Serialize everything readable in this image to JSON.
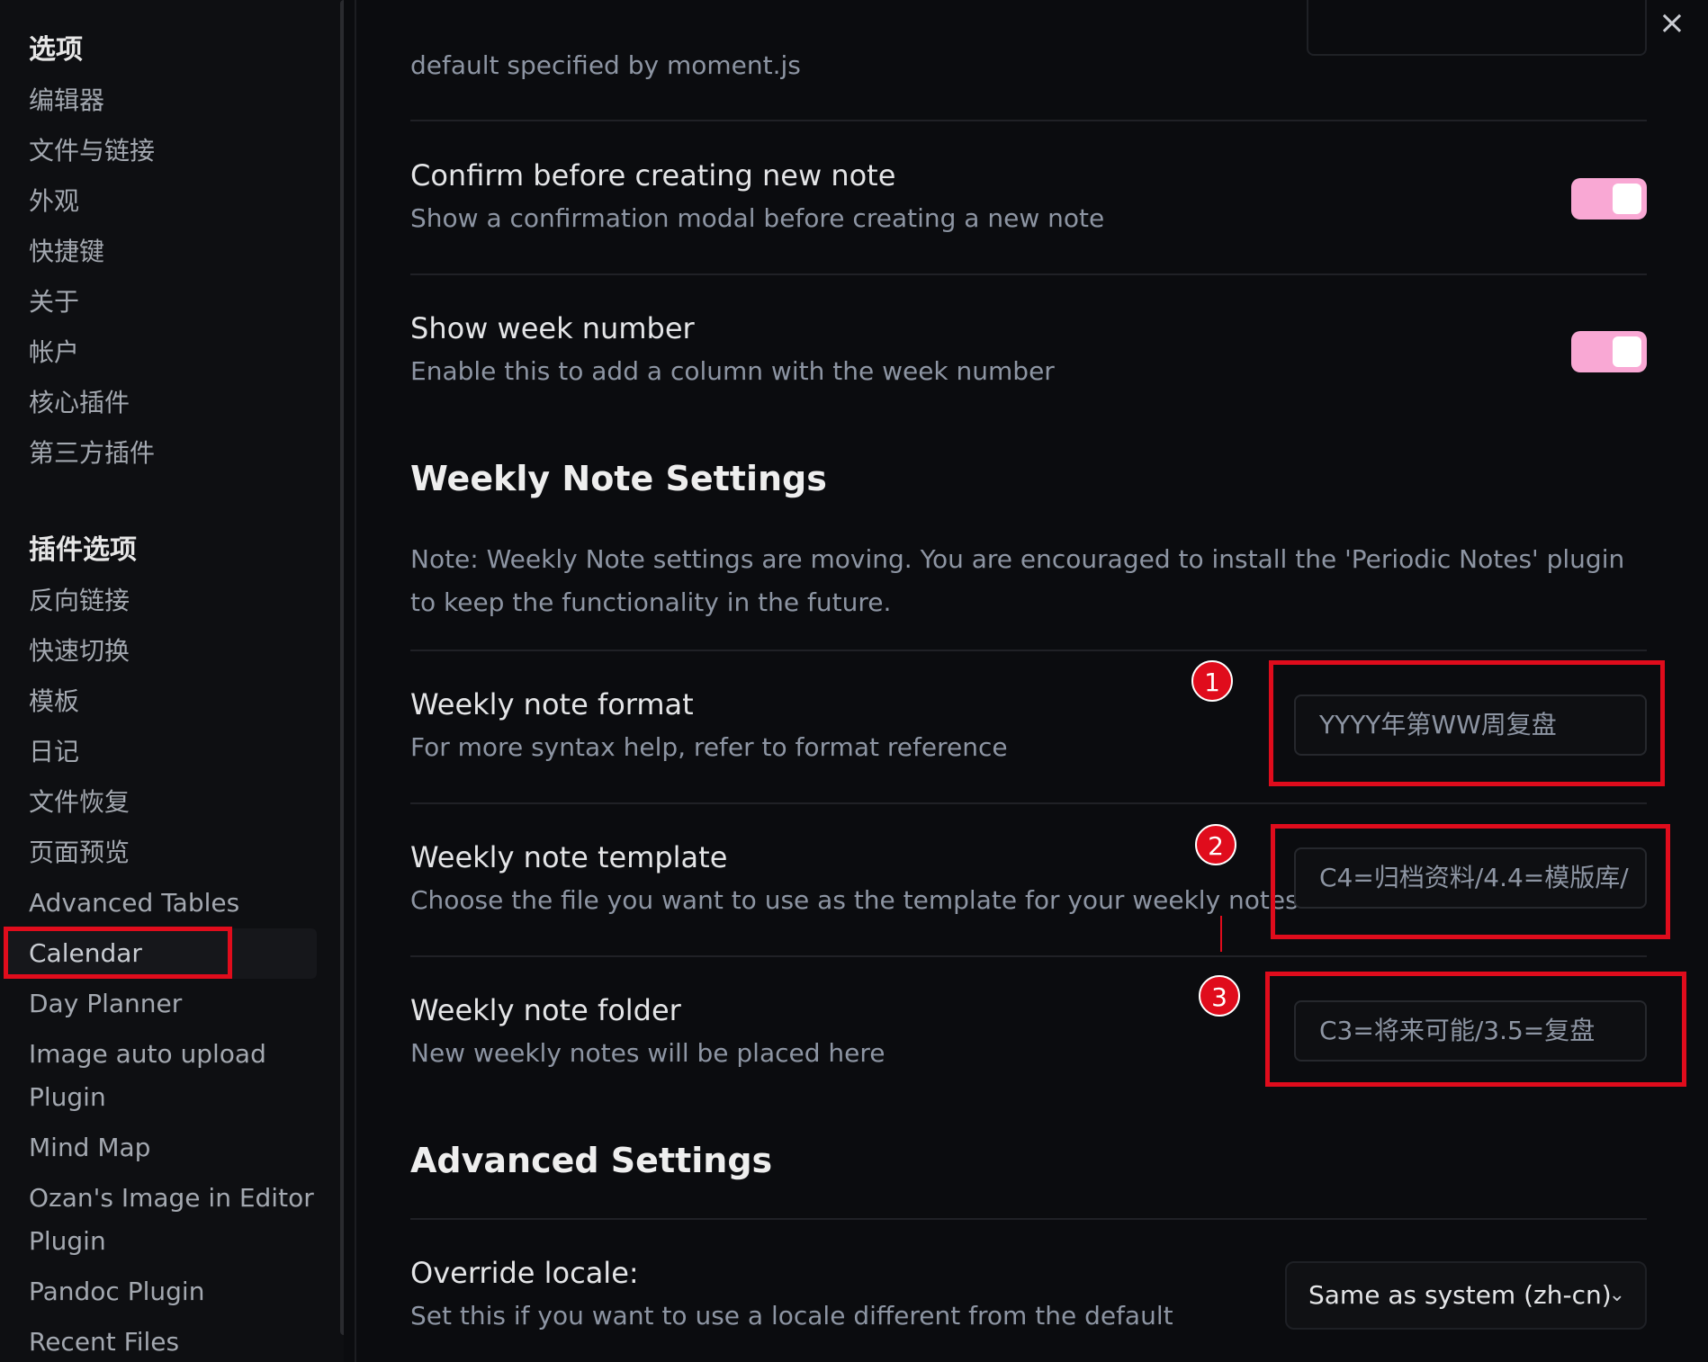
{
  "sidebar": {
    "options_heading": "选项",
    "options_items": [
      "编辑器",
      "文件与链接",
      "外观",
      "快捷键",
      "关于",
      "帐户",
      "核心插件",
      "第三方插件"
    ],
    "plugin_heading": "插件选项",
    "plugin_items": [
      "反向链接",
      "快速切换",
      "模板",
      "日记",
      "文件恢复",
      "页面预览",
      "Advanced Tables",
      "Calendar",
      "Day Planner",
      "Image auto upload",
      "Plugin",
      "Mind Map",
      "Ozan's Image in Editor",
      "Plugin",
      "Pandoc Plugin",
      "Recent Files"
    ],
    "active_item": "Calendar"
  },
  "main": {
    "close_icon": "×",
    "top_desc": "default specified by moment.js",
    "confirm_new_note": {
      "name": "Confirm before creating new note",
      "desc": "Show a confirmation modal before creating a new note",
      "enabled": true
    },
    "show_week_number": {
      "name": "Show week number",
      "desc": "Enable this to add a column with the week number",
      "enabled": true
    },
    "weekly_heading": "Weekly Note Settings",
    "weekly_note": "Note: Weekly Note settings are moving. You are encouraged to install the 'Periodic Notes' plugin to keep the functionality in the future.",
    "weekly_format": {
      "name": "Weekly note format",
      "desc": "For more syntax help, refer to format reference",
      "value": "YYYY年第WW周复盘",
      "badge": "1"
    },
    "weekly_template": {
      "name": "Weekly note template",
      "desc": "Choose the file you want to use as the template for your weekly notes",
      "value": "C4=归档资料/4.4=模版库/",
      "badge": "2"
    },
    "weekly_folder": {
      "name": "Weekly note folder",
      "desc": "New weekly notes will be placed here",
      "value": "C3=将来可能/3.5=复盘",
      "badge": "3"
    },
    "advanced_heading": "Advanced Settings",
    "override_locale": {
      "name": "Override locale:",
      "desc": "Set this if you want to use a locale different from the default",
      "value": "Same as system (zh-cn)"
    }
  },
  "colors": {
    "toggle_on": "#f9a8d4",
    "annotation_red": "#e00c1c"
  }
}
